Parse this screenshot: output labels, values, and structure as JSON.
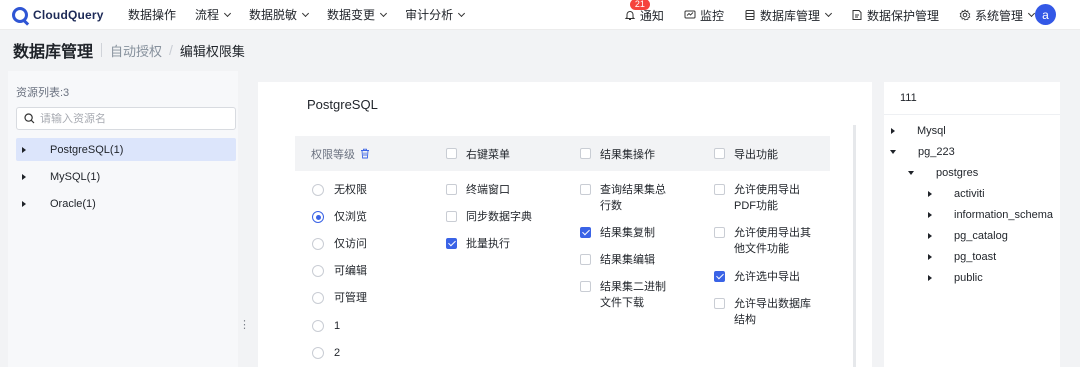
{
  "app": {
    "name": "CloudQuery"
  },
  "nav": {
    "items": [
      {
        "label": "数据操作",
        "has_caret": false
      },
      {
        "label": "流程",
        "has_caret": true
      },
      {
        "label": "数据脱敏",
        "has_caret": true
      },
      {
        "label": "数据变更",
        "has_caret": true
      },
      {
        "label": "审计分析",
        "has_caret": true
      }
    ],
    "right": [
      {
        "label": "通知",
        "icon": "bell-icon",
        "badge": "21"
      },
      {
        "label": "监控",
        "icon": "monitor-icon"
      },
      {
        "label": "数据库管理",
        "icon": "database-icon",
        "has_caret": true
      },
      {
        "label": "数据保护管理",
        "icon": "shield-icon"
      },
      {
        "label": "系统管理",
        "icon": "gear-icon",
        "has_caret": true
      }
    ],
    "avatar": "a"
  },
  "breadcrumb": {
    "title": "数据库管理",
    "link": "自动授权",
    "sep": "/",
    "current": "编辑权限集"
  },
  "resources": {
    "count_label": "资源列表:3",
    "search_placeholder": "请输入资源名",
    "items": [
      {
        "label": "PostgreSQL(1)",
        "selected": true
      },
      {
        "label": "MySQL(1)",
        "selected": false
      },
      {
        "label": "Oracle(1)",
        "selected": false
      }
    ]
  },
  "permissions": {
    "title": "PostgreSQL",
    "headers": {
      "level": "权限等级",
      "context_menu": "右键菜单",
      "resultset_ops": "结果集操作",
      "export": "导出功能"
    },
    "levels": [
      {
        "label": "无权限",
        "checked": false
      },
      {
        "label": "仅浏览",
        "checked": true
      },
      {
        "label": "仅访问",
        "checked": false
      },
      {
        "label": "可编辑",
        "checked": false
      },
      {
        "label": "可管理",
        "checked": false
      },
      {
        "label": "1",
        "checked": false
      },
      {
        "label": "2",
        "checked": false
      }
    ],
    "context_menu": [
      {
        "label": "终端窗口",
        "checked": false
      },
      {
        "label": "同步数据字典",
        "checked": false
      },
      {
        "label": "批量执行",
        "checked": true
      }
    ],
    "resultset": [
      {
        "label": "查询结果集总行数",
        "checked": false
      },
      {
        "label": "结果集复制",
        "checked": true
      },
      {
        "label": "结果集编辑",
        "checked": false
      },
      {
        "label": "结果集二进制文件下载",
        "checked": false
      }
    ],
    "export": [
      {
        "label": "允许使用导出PDF功能",
        "checked": false
      },
      {
        "label": "允许使用导出其他文件功能",
        "checked": false
      },
      {
        "label": "允许选中导出",
        "checked": true
      },
      {
        "label": "允许导出数据库结构",
        "checked": false
      }
    ]
  },
  "tree": {
    "title": "111",
    "nodes": [
      {
        "label": "Mysql",
        "expanded": false,
        "depth": 0
      },
      {
        "label": "pg_223",
        "expanded": true,
        "depth": 0
      },
      {
        "label": "postgres",
        "expanded": true,
        "depth": 1
      },
      {
        "label": "activiti",
        "expanded": false,
        "depth": 2
      },
      {
        "label": "information_schema",
        "expanded": false,
        "depth": 2
      },
      {
        "label": "pg_catalog",
        "expanded": false,
        "depth": 2
      },
      {
        "label": "pg_toast",
        "expanded": false,
        "depth": 2
      },
      {
        "label": "public",
        "expanded": false,
        "depth": 2
      }
    ]
  },
  "colors": {
    "primary": "#3a63e6",
    "selected_bg": "#dce5fb",
    "badge": "#f5433d"
  }
}
